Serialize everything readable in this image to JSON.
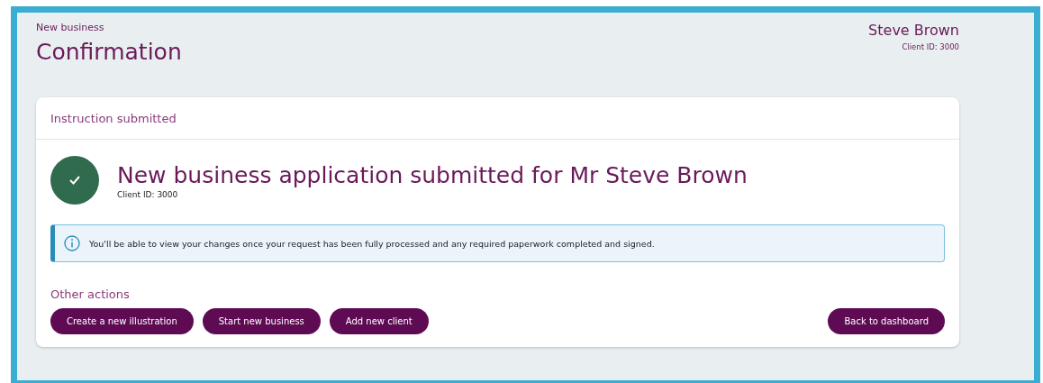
{
  "header": {
    "breadcrumb": "New business",
    "title": "Confirmation",
    "user_name": "Steve Brown",
    "user_client_id": "Client ID: 3000"
  },
  "card": {
    "heading": "Instruction submitted",
    "message": "New business application submitted for Mr Steve Brown",
    "client_id": "Client ID: 3000",
    "info": "You'll be able to view your changes once your request has been fully processed and any required paperwork completed and signed.",
    "actions_heading": "Other actions",
    "actions": [
      "Create a new illustration",
      "Start new business",
      "Add new client"
    ],
    "back_button": "Back to dashboard"
  }
}
